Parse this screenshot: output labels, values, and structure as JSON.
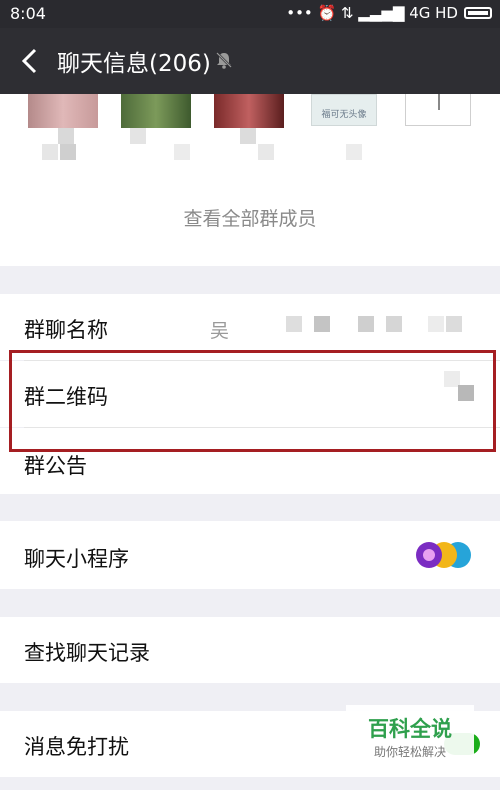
{
  "status_bar": {
    "time": "8:04",
    "indicators": "••• ⏰ ⇅ ▂▃▅▇ 4G HD"
  },
  "header": {
    "title": "聊天信息(206)",
    "back_icon": "chevron-left-icon",
    "mute_icon": "bell-off-icon"
  },
  "members": {
    "avatar_caption": "福可无头像",
    "see_all_label": "查看全部群成员"
  },
  "settings": {
    "group_name_label": "群聊名称",
    "group_name_value": "吴",
    "qr_label": "群二维码",
    "notice_label": "群公告",
    "mini_programs_label": "聊天小程序",
    "search_history_label": "查找聊天记录",
    "dnd_label": "消息免打扰"
  },
  "watermark": {
    "title": "百科全说",
    "subtitle": "助你轻松解决"
  },
  "colors": {
    "highlight_border": "#a51e22",
    "nav_bg": "#2e2e33",
    "accent_green": "#2fa04d"
  }
}
